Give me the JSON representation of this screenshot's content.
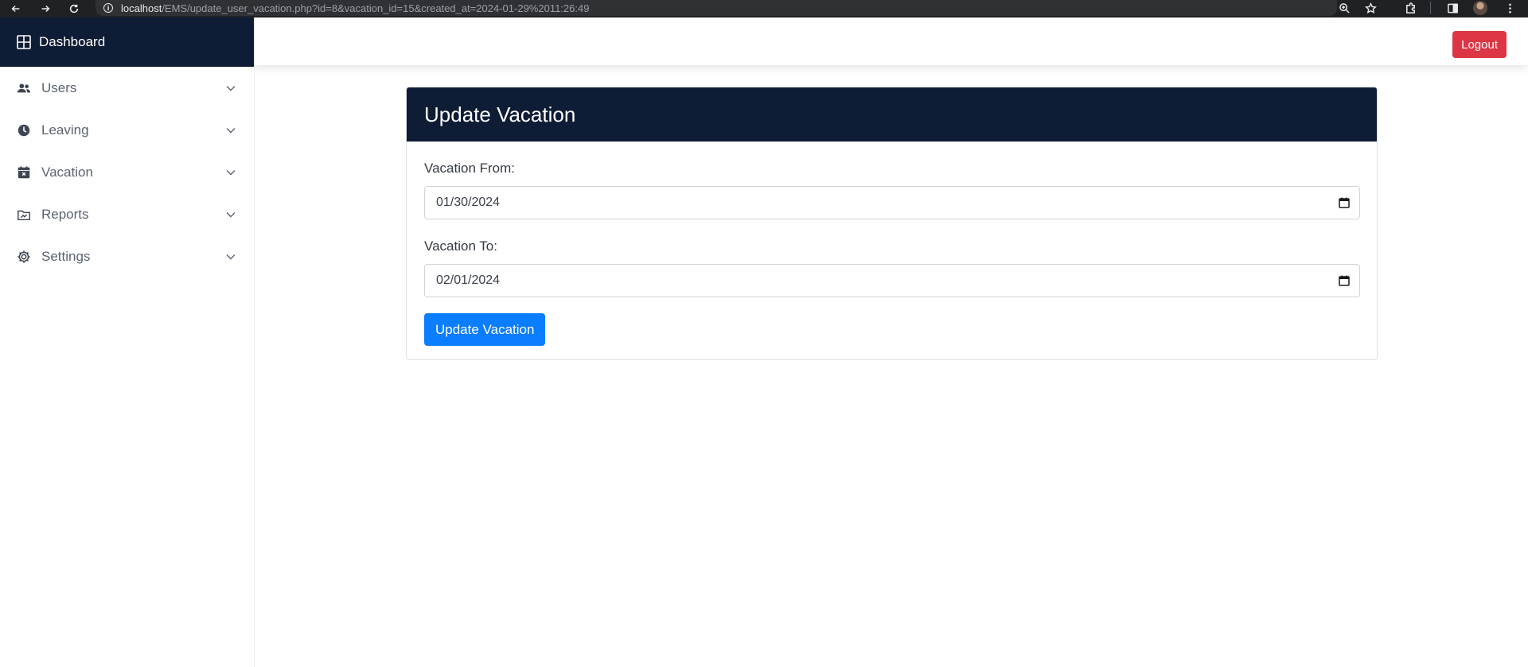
{
  "browser": {
    "url_host": "localhost",
    "url_path": "/EMS/update_user_vacation.php?id=8&vacation_id=15&created_at=2024-01-29%2011:26:49"
  },
  "sidebar": {
    "brand": "Dashboard",
    "items": [
      {
        "label": "Users",
        "icon": "users-icon"
      },
      {
        "label": "Leaving",
        "icon": "clock-icon"
      },
      {
        "label": "Vacation",
        "icon": "calendar-x-icon"
      },
      {
        "label": "Reports",
        "icon": "folder-chart-icon"
      },
      {
        "label": "Settings",
        "icon": "gear-icon"
      }
    ]
  },
  "topbar": {
    "logout_label": "Logout"
  },
  "form": {
    "title": "Update Vacation",
    "from_label": "Vacation From:",
    "from_value": "01/30/2024",
    "to_label": "Vacation To:",
    "to_value": "02/01/2024",
    "submit_label": "Update Vacation"
  },
  "colors": {
    "navy": "#0f1c35",
    "primary": "#0b7dff",
    "danger": "#dc3545"
  }
}
